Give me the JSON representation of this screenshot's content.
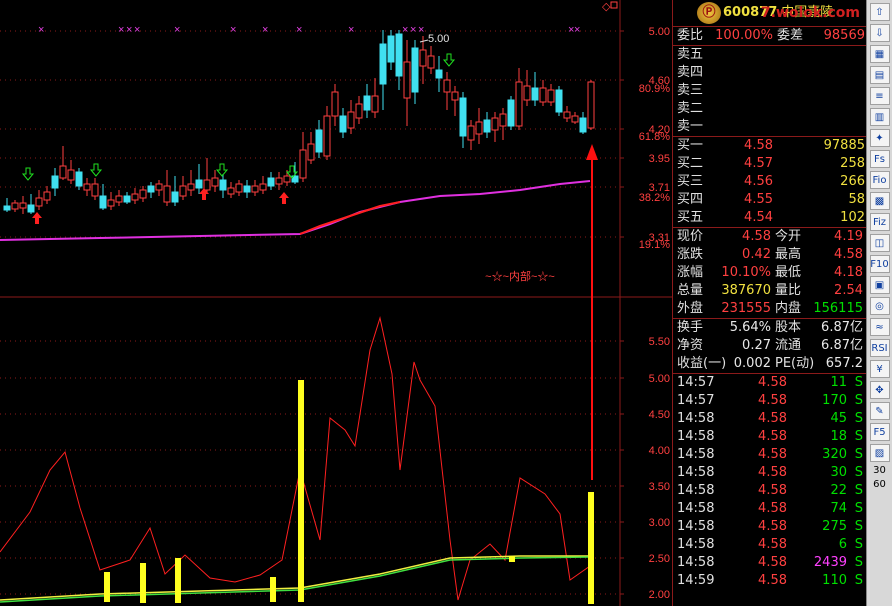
{
  "stock": {
    "code": "600877",
    "name": "中国嘉陵",
    "watermark": "7.wolok.com"
  },
  "price_axis": {
    "ticks": [
      "5.00",
      "4.60",
      "4.20",
      "3.95",
      "3.71",
      "3.31"
    ],
    "pct": [
      "80.9%",
      "61.8%",
      "38.2%",
      "19.1%"
    ],
    "annotation": "5.00",
    "inner_label": "~☆~内部~☆~"
  },
  "vol_axis": {
    "ticks": [
      "5.50",
      "5.00",
      "4.50",
      "4.00",
      "3.50",
      "3.00",
      "2.50",
      "2.00"
    ]
  },
  "order_book": {
    "ratio_label": "委比",
    "ratio_value": "100.00%",
    "diff_label": "委差",
    "diff_value": "98569",
    "asks": [
      {
        "label": "卖五",
        "price": "",
        "vol": ""
      },
      {
        "label": "卖四",
        "price": "",
        "vol": ""
      },
      {
        "label": "卖三",
        "price": "",
        "vol": ""
      },
      {
        "label": "卖二",
        "price": "",
        "vol": ""
      },
      {
        "label": "卖一",
        "price": "",
        "vol": ""
      }
    ],
    "bids": [
      {
        "label": "买一",
        "price": "4.58",
        "vol": "97885"
      },
      {
        "label": "买二",
        "price": "4.57",
        "vol": "258"
      },
      {
        "label": "买三",
        "price": "4.56",
        "vol": "266"
      },
      {
        "label": "买四",
        "price": "4.55",
        "vol": "58"
      },
      {
        "label": "买五",
        "price": "4.54",
        "vol": "102"
      }
    ]
  },
  "stats": [
    {
      "l1": "现价",
      "v1": "4.58",
      "c1": "r",
      "l2": "今开",
      "v2": "4.19",
      "c2": "r"
    },
    {
      "l1": "涨跌",
      "v1": "0.42",
      "c1": "r",
      "l2": "最高",
      "v2": "4.58",
      "c2": "r"
    },
    {
      "l1": "涨幅",
      "v1": "10.10%",
      "c1": "r",
      "l2": "最低",
      "v2": "4.18",
      "c2": "r"
    },
    {
      "l1": "总量",
      "v1": "387670",
      "c1": "y",
      "l2": "量比",
      "v2": "2.54",
      "c2": "r"
    },
    {
      "l1": "外盘",
      "v1": "231555",
      "c1": "r",
      "l2": "内盘",
      "v2": "156115",
      "c2": "g"
    }
  ],
  "fundamentals": [
    {
      "l1": "换手",
      "v1": "5.64%",
      "l2": "股本",
      "v2": "6.87亿"
    },
    {
      "l1": "净资",
      "v1": "0.27",
      "l2": "流通",
      "v2": "6.87亿"
    },
    {
      "l1": "收益(一)",
      "v1": "0.002",
      "l2": "PE(动)",
      "v2": "657.2"
    }
  ],
  "ticks": [
    {
      "t": "14:57",
      "p": "4.58",
      "q": "11",
      "qc": "g",
      "s": "S"
    },
    {
      "t": "14:57",
      "p": "4.58",
      "q": "170",
      "qc": "g",
      "s": "S"
    },
    {
      "t": "14:58",
      "p": "4.58",
      "q": "45",
      "qc": "g",
      "s": "S"
    },
    {
      "t": "14:58",
      "p": "4.58",
      "q": "18",
      "qc": "g",
      "s": "S"
    },
    {
      "t": "14:58",
      "p": "4.58",
      "q": "320",
      "qc": "g",
      "s": "S"
    },
    {
      "t": "14:58",
      "p": "4.58",
      "q": "30",
      "qc": "g",
      "s": "S"
    },
    {
      "t": "14:58",
      "p": "4.58",
      "q": "22",
      "qc": "g",
      "s": "S"
    },
    {
      "t": "14:58",
      "p": "4.58",
      "q": "74",
      "qc": "g",
      "s": "S"
    },
    {
      "t": "14:58",
      "p": "4.58",
      "q": "275",
      "qc": "g",
      "s": "S"
    },
    {
      "t": "14:58",
      "p": "4.58",
      "q": "6",
      "qc": "g",
      "s": "S"
    },
    {
      "t": "14:58",
      "p": "4.58",
      "q": "2439",
      "qc": "m",
      "s": "S"
    },
    {
      "t": "14:59",
      "p": "4.58",
      "q": "110",
      "qc": "g",
      "s": "S"
    }
  ],
  "toolbar": [
    "⇧",
    "⇩",
    "▦",
    "▤",
    "≡",
    "▥",
    "✦",
    "Fs",
    "Fio",
    "▩",
    "Fiz",
    "◫",
    "F10",
    "▣",
    "◎",
    "≈",
    "RSI",
    "¥",
    "✥",
    "✎",
    "F5",
    "▨",
    "30",
    "60"
  ],
  "colors": {
    "up": "#ff4040",
    "down": "#40e0f0",
    "ma_long": "#e030e0",
    "ma_long2": "#ff2020",
    "vol_bar": "#ffff20",
    "vol_line": "#ff2020",
    "ma5": "#f0f040",
    "ma10": "#40e040",
    "grid": "#8b1a1a"
  }
}
